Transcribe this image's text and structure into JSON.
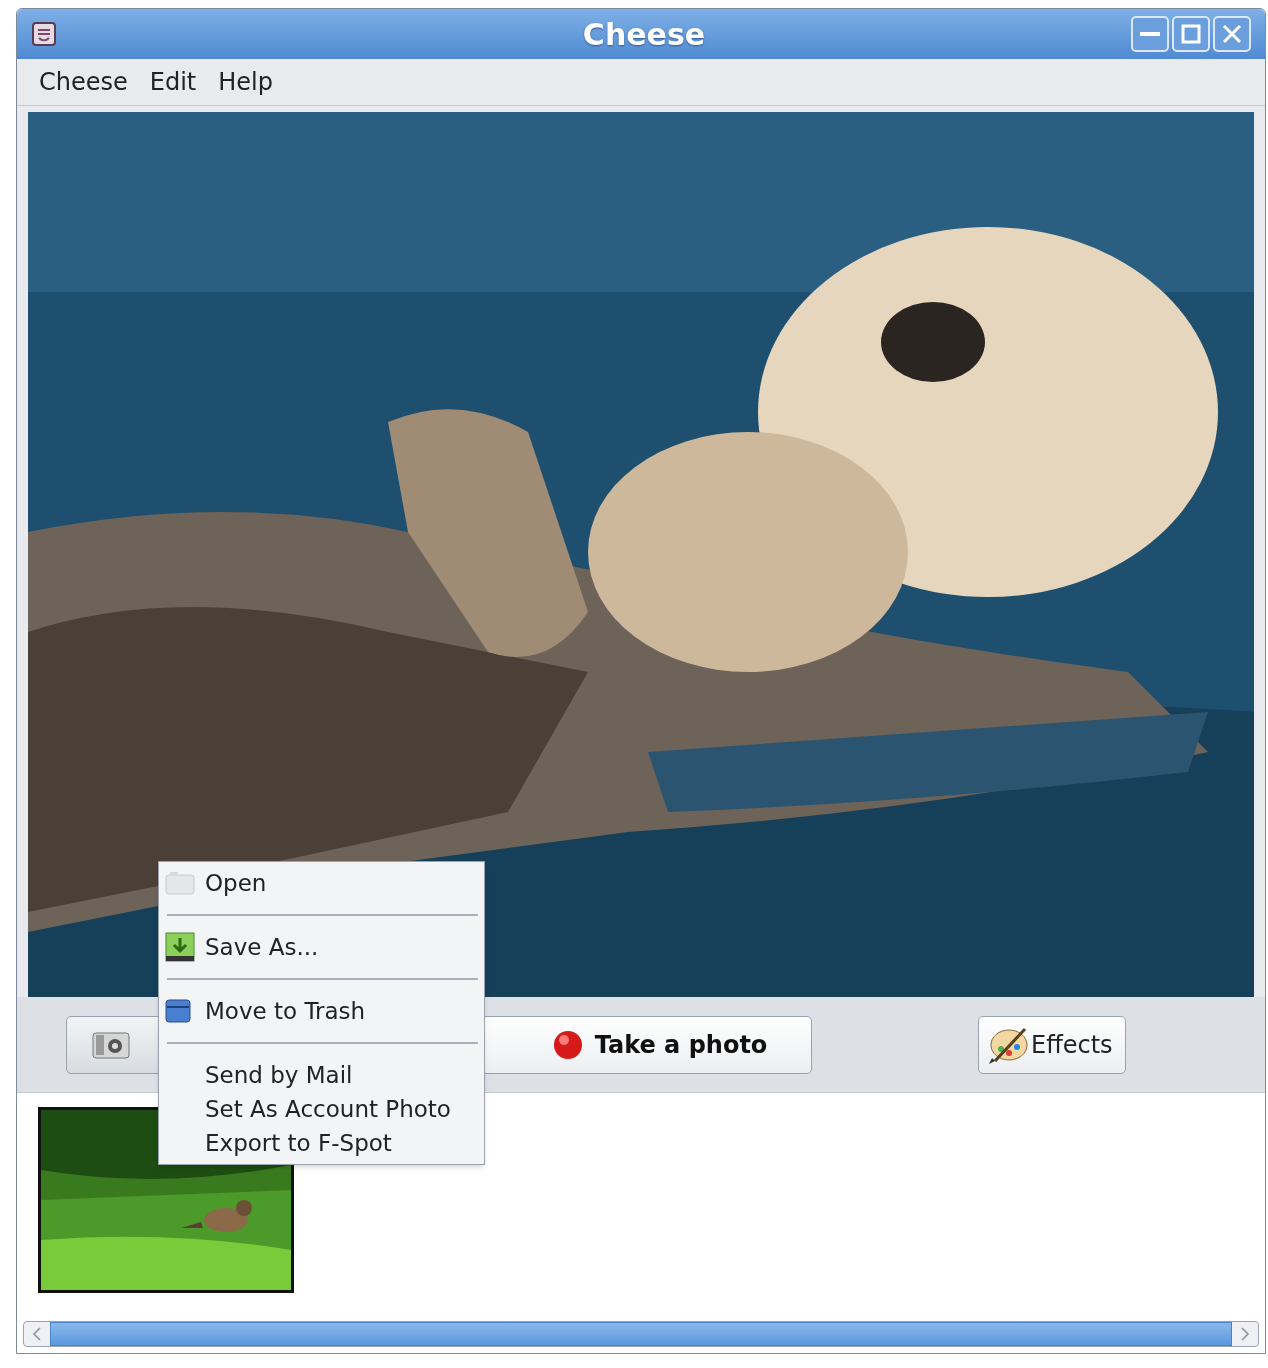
{
  "window": {
    "title": "Cheese"
  },
  "menu_bar": [
    "Cheese",
    "Edit",
    "Help"
  ],
  "viewer": {
    "kind": "picture"
  },
  "buttons": [
    {
      "kind": "mode"
    },
    {
      "kind": "take",
      "label": "Take a photo"
    },
    {
      "kind": "effects",
      "label": "Effects"
    }
  ],
  "thumbnails": [
    {
      "kind": "picture",
      "selected": true
    }
  ],
  "context_menu": [
    {
      "kind": "open",
      "label": "Open"
    },
    {
      "kind": "separator"
    },
    {
      "kind": "save",
      "label": "Save As..."
    },
    {
      "kind": "separator"
    },
    {
      "kind": "trash",
      "label": "Move to Trash"
    },
    {
      "kind": "separator"
    },
    {
      "kind": "text",
      "label": "Send by Mail"
    },
    {
      "kind": "text",
      "label": "Set As Account Photo"
    },
    {
      "kind": "text",
      "label": "Export to F-Spot"
    }
  ]
}
